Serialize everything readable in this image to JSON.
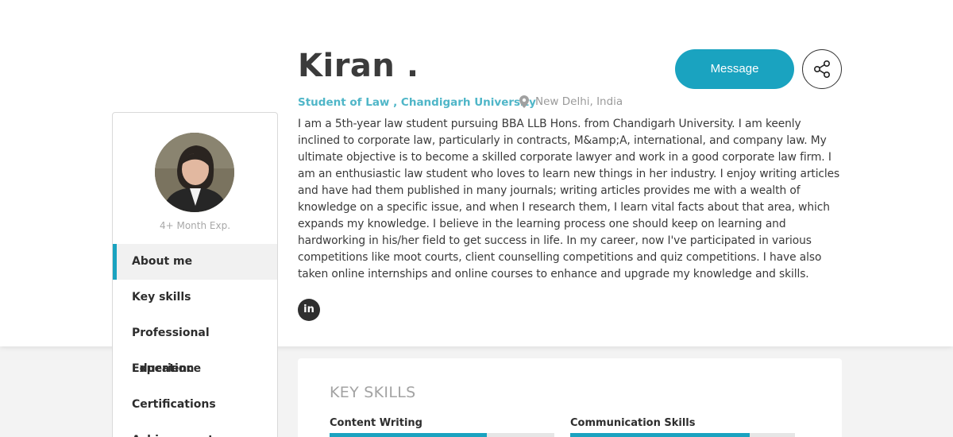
{
  "profile": {
    "name": "Kiran .",
    "subtitle": "Student of Law , Chandigarh University",
    "location": "New Delhi, India",
    "bio": "I am a 5th-year law student pursuing BBA LLB Hons. from Chandigarh University. I am keenly inclined to corporate law, particularly in contracts, M&amp;A, international, and company law. My ultimate objective is to become a skilled corporate lawyer and work in a good corporate law firm. I am an enthusiastic law student who loves to learn new things in her industry. I enjoy writing articles and have had them published in many journals; writing articles provides me with a wealth of knowledge on a specific issue, and when I research them, I learn vital facts about that area, which expands my knowledge. I believe in the learning process one should keep on learning and hardworking in his/her field to get success in life. In my career, now I've participated in various competitions like moot courts, client counselling competitions and quiz competitions. I have also taken online internships and online courses to enhance and upgrade my knowledge and skills.",
    "experience": "4+ Month Exp.",
    "social_icon": "in"
  },
  "actions": {
    "message_label": "Message",
    "share_icon": "share-icon"
  },
  "sidebar": {
    "items": [
      {
        "label": "About me",
        "active": true
      },
      {
        "label": "Key skills",
        "active": false
      },
      {
        "label": "Professional Experience",
        "active": false
      },
      {
        "label": "Education",
        "active": false
      },
      {
        "label": "Certifications",
        "active": false
      },
      {
        "label": "Achievements",
        "active": false
      }
    ]
  },
  "skills": {
    "title": "KEY SKILLS",
    "items": [
      {
        "label": "Content Writing",
        "level": 0.7
      },
      {
        "label": "Communication Skills",
        "level": 0.8
      }
    ]
  },
  "colors": {
    "accent": "#1aa3c0",
    "subtitle": "#4fb6c8"
  }
}
